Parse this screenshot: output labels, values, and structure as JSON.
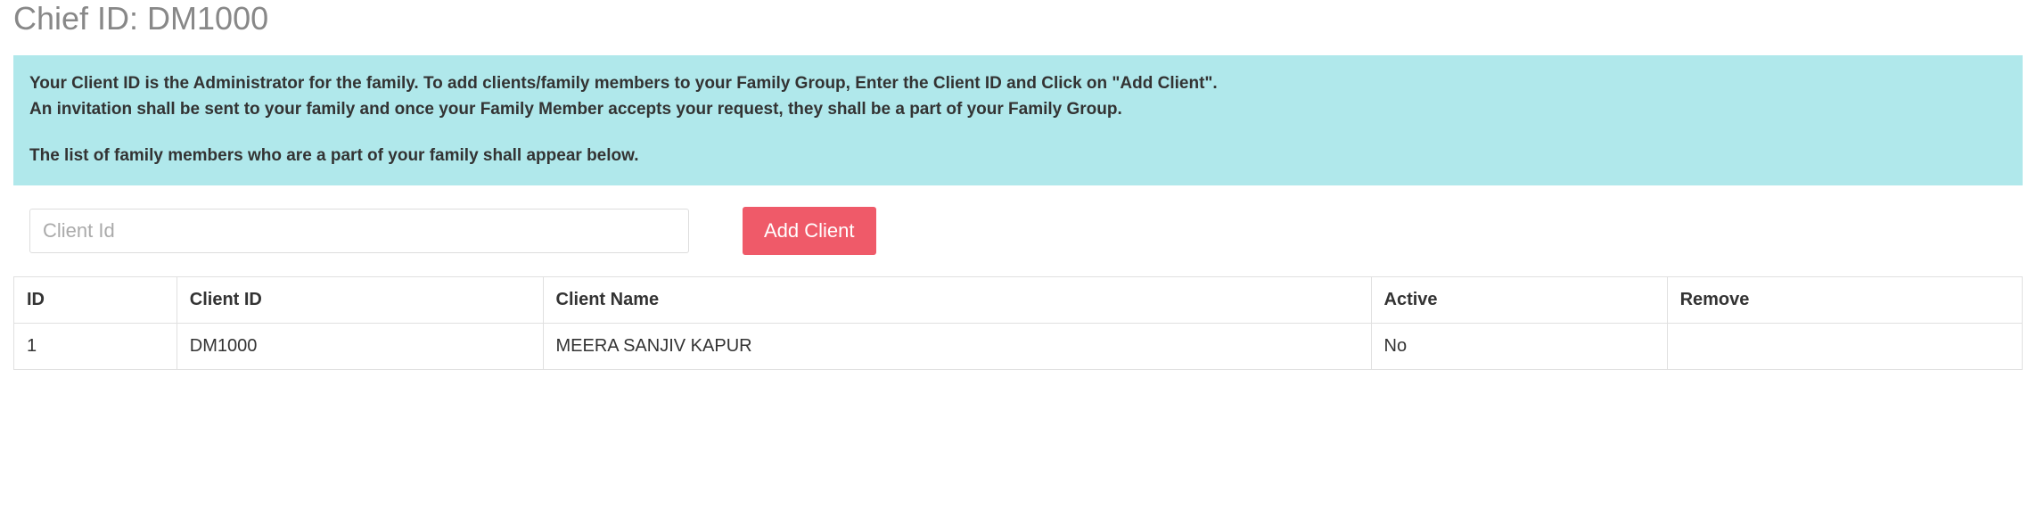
{
  "header": {
    "title": "Chief ID: DM1000"
  },
  "banner": {
    "line1": "Your Client ID is the Administrator for the family. To add clients/family members to your Family Group, Enter the Client ID and Click on \"Add Client\".",
    "line2": "An invitation shall be sent to your family and once your Family Member accepts your request, they shall be a part of your Family Group.",
    "line3": "The list of family members who are a part of your family shall appear below."
  },
  "form": {
    "client_id_placeholder": "Client Id",
    "client_id_value": "",
    "add_button_label": "Add Client"
  },
  "table": {
    "headers": {
      "id": "ID",
      "client_id": "Client ID",
      "client_name": "Client Name",
      "active": "Active",
      "remove": "Remove"
    },
    "rows": [
      {
        "id": "1",
        "client_id": "DM1000",
        "client_name": "MEERA SANJIV KAPUR",
        "active": "No",
        "remove": ""
      }
    ]
  }
}
